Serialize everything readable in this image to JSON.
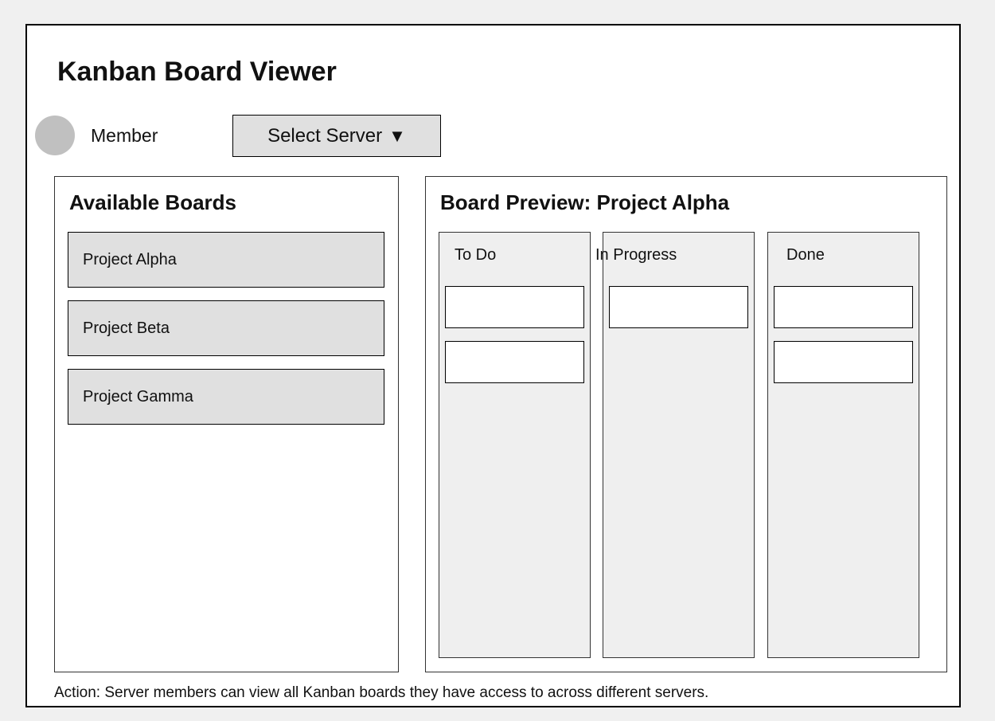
{
  "app": {
    "title": "Kanban Board Viewer"
  },
  "user": {
    "role": "Member"
  },
  "server_select": {
    "label": "Select Server",
    "arrow": "▼"
  },
  "boards_panel": {
    "title": "Available Boards",
    "items": [
      {
        "label": "Project Alpha"
      },
      {
        "label": "Project Beta"
      },
      {
        "label": "Project Gamma"
      }
    ]
  },
  "preview": {
    "title": "Board Preview: Project Alpha",
    "columns": [
      {
        "title": "To Do",
        "card_count": 2
      },
      {
        "title": "In Progress",
        "card_count": 1
      },
      {
        "title": "Done",
        "card_count": 2
      }
    ]
  },
  "footer": {
    "text": "Action: Server members can view all Kanban boards they have access to across different servers."
  },
  "colors": {
    "background": "#f0f0f0",
    "frame_border": "#000000",
    "item_fill": "#e0e0e0",
    "column_fill": "#efefef",
    "avatar": "#c0c0c0",
    "card_fill": "#ffffff"
  }
}
